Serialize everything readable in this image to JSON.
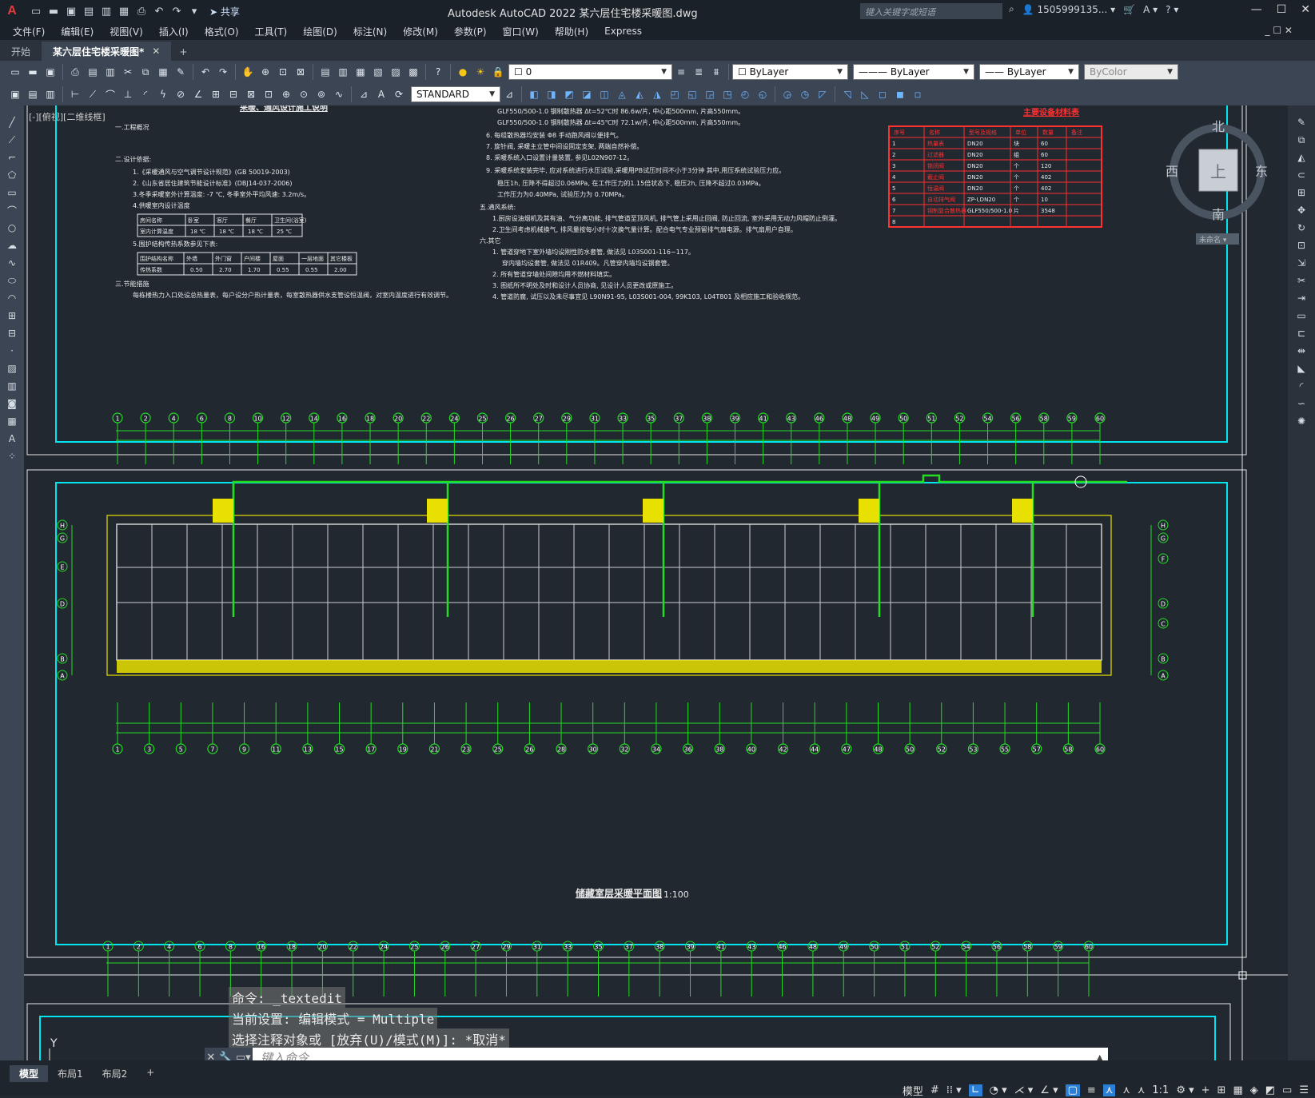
{
  "app": {
    "logo": "A",
    "title": "Autodesk AutoCAD 2022    某六层住宅楼采暖图.dwg",
    "share": "共享",
    "search_placeholder": "键入关键字或短语",
    "user": "1505999135...",
    "window_controls": [
      "—",
      "☐",
      "✕"
    ]
  },
  "menu": [
    "文件(F)",
    "编辑(E)",
    "视图(V)",
    "插入(I)",
    "格式(O)",
    "工具(T)",
    "绘图(D)",
    "标注(N)",
    "修改(M)",
    "参数(P)",
    "窗口(W)",
    "帮助(H)",
    "Express"
  ],
  "menu_right": "_ ☐ ✕",
  "tabs": {
    "start": "开始",
    "active": "某六层住宅楼采暖图*",
    "close": "✕",
    "add": "+"
  },
  "toolbar": {
    "layer_value": "0",
    "color_value": "ByLayer",
    "linetype_value": "ByLayer",
    "lineweight_value": "ByLayer",
    "plotstyle_value": "ByColor",
    "textstyle_value": "STANDARD"
  },
  "viewport_label": "[-][俯视][二维线框]",
  "viewcube": {
    "north": "北",
    "south": "南",
    "east": "东",
    "west": "西",
    "top": "上",
    "wcs": "未命名 ▾"
  },
  "drawing": {
    "section1_title": "采暖、通风设计施工说明",
    "notes_left": [
      "一.工程概况",
      "二.设计依据:",
      "1.《采暖通风与空气调节设计规范》(GB 50019-2003)",
      "2.《山东省居住建筑节能设计标准》(DBJ14-037-2006)",
      "3.冬季采暖室外计算温度: -7 ℃, 冬季室外平均风速: 3.2m/s。",
      "4.供暖室内设计温度",
      "5.围护结构传热系数参见下表:",
      "三.节能措施",
      "每栋楼热力入口处设总热量表，每户设分户热计量表，每室散热器供水支管设恒温阀，对室内温度进行有效调节。"
    ],
    "temp_table": {
      "headers": [
        "房间名称",
        "卧室",
        "客厅",
        "餐厅",
        "卫生间(浴室)"
      ],
      "row_label": "室内计算温度",
      "values": [
        "18 ℃",
        "18 ℃",
        "18 ℃",
        "25 ℃"
      ]
    },
    "k_table": {
      "headers": [
        "围护结构名称",
        "外墙",
        "外门窗",
        "户间楼",
        "屋面",
        "一层地面",
        "其它楼板"
      ],
      "row_label": "传热系数",
      "values": [
        "0.50",
        "2.70",
        "1.70",
        "0.55",
        "0.55",
        "2.00"
      ]
    },
    "notes_middle": [
      "GLF550/500-1.0 钢制散热器   Δt=52℃时 86.6w/片, 中心距500mm, 片高550mm。",
      "GLF550/500-1.0 钢制散热器   Δt=45℃时 72.1w/片, 中心距500mm, 片高550mm。",
      "6. 每组散热器均安装 Φ8 手动跑风阀以便排气。",
      "7. 旋针阀, 采暖主立管中间设固定支架, 两端自然补偿。",
      "8. 采暖系统入口设置计量装置, 参见L02N907-12。",
      "9. 采暖系统安装完毕, 应对系统进行水压试验,采暖用PB试压时间不小于3分钟 其中,用压系统试验压力应。",
      "稳压1h, 压降不得超过0.06MPa, 在工作压力的1.15倍状态下, 稳压2h, 压降不超过0.03MPa。",
      "工作压力为0.40MPa, 试验压力为 0.70MPa。",
      "五.通风系统:",
      "1.厨房设油烟机及其有油、气分离功能, 排气管道至顶风机, 排气管上采用止回阀, 防止回流, 室外采用无动力风帽防止倒灌。",
      "2.卫生间考虑机械换气, 排风量按每小时十次换气量计算。配合电气专业预留排气扇电源。排气扇用户自理。",
      "六.其它",
      "1. 管道穿地下室外墙均设刚性防水套管, 做法见 L03S001-116~117。",
      "穿内墙均设套管, 做法见 01R409。凡管穿内墙均设钢套管。",
      "2. 所有管道穿墙处间隙均用不燃材料填实。",
      "3. 图纸所不明处及时和设计人员协商, 见设计人员更改或原施工。",
      "4. 管道防腐, 试压以及未尽事宜见 L90N91-95, L03S001-004, 99K103, L04T801 及相应施工和验收规范。"
    ],
    "equip_title": "主要设备材料表",
    "equip_table": {
      "headers": [
        "序号",
        "名称",
        "型号及规格",
        "单位",
        "数量",
        "备注"
      ],
      "rows": [
        [
          "1",
          "热量表",
          "DN20",
          "块",
          "60",
          ""
        ],
        [
          "2",
          "过滤器",
          "DN20",
          "组",
          "60",
          ""
        ],
        [
          "3",
          "锁闭阀",
          "DN20",
          "个",
          "120",
          ""
        ],
        [
          "4",
          "截止阀",
          "DN20",
          "个",
          "402",
          ""
        ],
        [
          "5",
          "恒温阀",
          "DN20",
          "个",
          "402",
          ""
        ],
        [
          "6",
          "自动排气阀",
          "ZP-I,DN20",
          "个",
          "10",
          ""
        ],
        [
          "7",
          "钢制复合散热器",
          "GLF550/500-1.0",
          "片",
          "3548",
          ""
        ],
        [
          "8",
          "",
          "",
          "",
          "",
          ""
        ]
      ]
    },
    "axis_top": [
      "1",
      "2",
      "4",
      "6",
      "8",
      "10",
      "12",
      "14",
      "16",
      "18",
      "20",
      "22",
      "24",
      "25",
      "26",
      "27",
      "29",
      "31",
      "33",
      "35",
      "37",
      "38",
      "39",
      "41",
      "43",
      "46",
      "48",
      "49",
      "50",
      "51",
      "52",
      "54",
      "56",
      "58",
      "59",
      "60"
    ],
    "axis_bottom": [
      "1",
      "3",
      "5",
      "7",
      "9",
      "11",
      "13",
      "15",
      "17",
      "19",
      "21",
      "23",
      "25",
      "26",
      "28",
      "30",
      "32",
      "34",
      "36",
      "38",
      "40",
      "42",
      "44",
      "47",
      "48",
      "50",
      "52",
      "53",
      "55",
      "57",
      "58",
      "60"
    ],
    "axis_rows_left": [
      "H",
      "G",
      "E",
      "D",
      "B",
      "A"
    ],
    "axis_rows_right": [
      "H",
      "G",
      "F",
      "D",
      "C",
      "B",
      "A"
    ],
    "plan_title": "储藏室层采暖平面图",
    "plan_scale": "1:100",
    "section3_axis": [
      "1",
      "2",
      "4",
      "6",
      "8",
      "16",
      "18",
      "20",
      "22",
      "24",
      "25",
      "26",
      "27",
      "29",
      "31",
      "33",
      "35",
      "37",
      "38",
      "39",
      "41",
      "43",
      "46",
      "48",
      "49",
      "50",
      "51",
      "52",
      "54",
      "56",
      "58",
      "59",
      "60"
    ]
  },
  "ucs": {
    "x": "X",
    "y": "Y"
  },
  "command_history": [
    "命令: _textedit",
    "当前设置: 编辑模式 = Multiple",
    "选择注释对象或 [放弃(U)/模式(M)]: *取消*"
  ],
  "command_placeholder": "键入命令",
  "layouts": [
    "模型",
    "布局1",
    "布局2"
  ],
  "layout_add": "+",
  "status": {
    "model": "模型",
    "scale": "1:1"
  }
}
